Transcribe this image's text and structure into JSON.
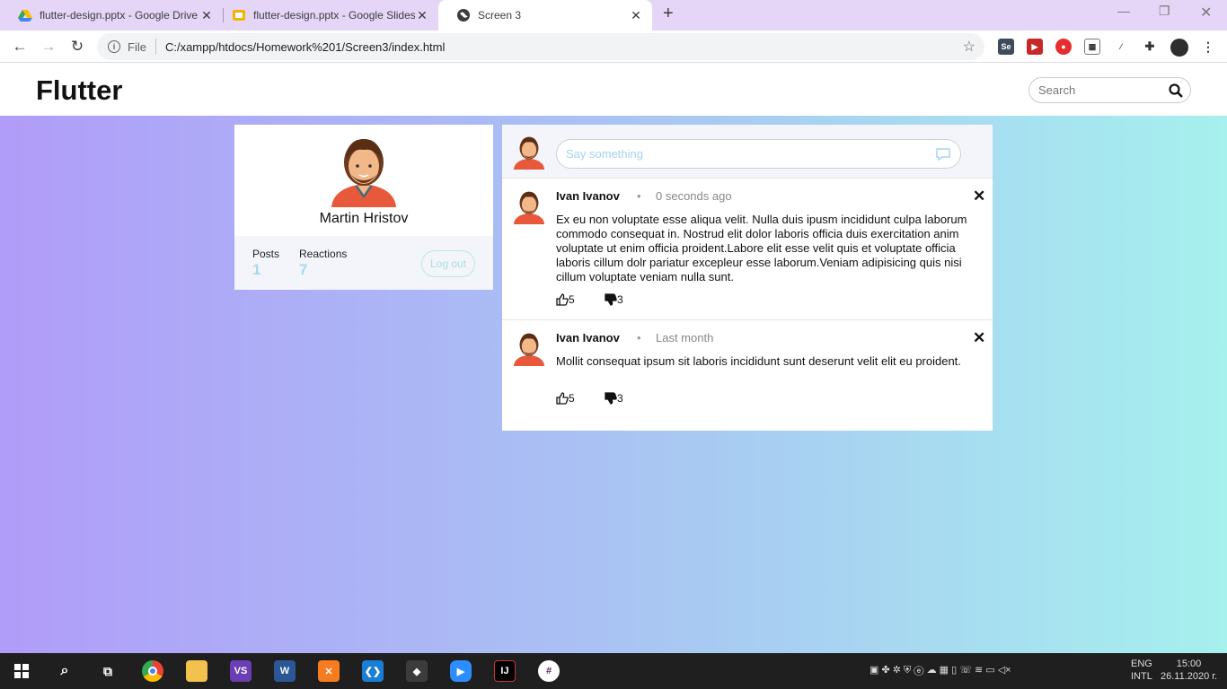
{
  "browser": {
    "tabs": [
      {
        "title": "flutter-design.pptx - Google Drive",
        "active": false
      },
      {
        "title": "flutter-design.pptx - Google Slides",
        "active": false
      },
      {
        "title": "Screen 3",
        "active": true
      }
    ],
    "address": {
      "scheme_label": "File",
      "url": "C:/xampp/htdocs/Homework%201/Screen3/index.html"
    }
  },
  "app": {
    "brand": "Flutter",
    "search": {
      "placeholder": "Search"
    }
  },
  "profile": {
    "name": "Martin Hristov",
    "posts_label": "Posts",
    "posts_value": "1",
    "reactions_label": "Reactions",
    "reactions_value": "7",
    "logout_label": "Log out"
  },
  "composer": {
    "placeholder": "Say something"
  },
  "posts": [
    {
      "author": "Ivan Ivanov",
      "time": "0 seconds ago",
      "body": "Ex eu non voluptate esse aliqua velit. Nulla duis ipusm incididunt culpa laborum commodo consequat in. Nostrud elit dolor laboris officia duis exercitation anim voluptate ut enim officia proident.Labore elit esse velit quis et voluptate officia laboris cillum dolr pariatur excepleur esse laborum.Veniam adipisicing quis nisi cillum voluptate veniam nulla sunt.",
      "likes": "5",
      "dislikes": "3"
    },
    {
      "author": "Ivan Ivanov",
      "time": "Last month",
      "body": "Mollit consequat ipsum sit laboris incididunt sunt deserunt velit elit eu proident.",
      "likes": "5",
      "dislikes": "3"
    }
  ],
  "taskbar": {
    "lang_line1": "ENG",
    "lang_line2": "INTL",
    "time": "15:00",
    "date": "26.11.2020 г."
  },
  "colors": {
    "accent_light": "#a8d8f0",
    "gradient_start": "#b09cf9",
    "gradient_end": "#a6f0ee"
  }
}
